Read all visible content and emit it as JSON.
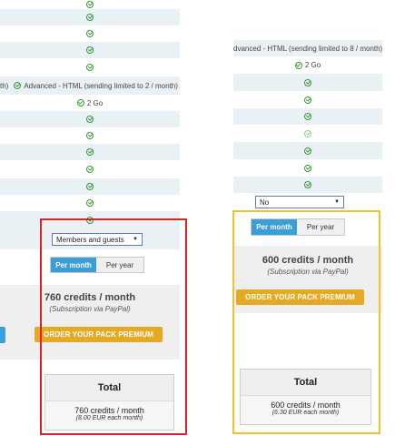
{
  "left_table": {
    "advanced_text": "Advanced - HTML (sending limited to 2 / month)",
    "advanced_prefix": "th)",
    "storage_text": "2 Go"
  },
  "right_table": {
    "advanced_text": "dvanced - HTML (sending limited to 8 / month)",
    "storage_text": "2 Go",
    "select_value": "No"
  },
  "left_panel": {
    "audience_select": "Members and guests",
    "toggle_on": "Per month",
    "toggle_off": "Per year",
    "price": "760 credits / month",
    "price_note": "(Subscription via PayPal)",
    "order_button": "ORDER YOUR PACK PREMIUM",
    "total_label": "Total",
    "total_value": "760 credits / month",
    "total_note": "(8.00 EUR each month)"
  },
  "right_panel": {
    "toggle_on": "Per month",
    "toggle_off": "Per year",
    "price": "600 credits / month",
    "price_note": "(Subscription via PayPal)",
    "order_button": "ORDER YOUR PACK PREMIUM",
    "total_label": "Total",
    "total_value": "600 credits / month",
    "total_note": "(6.30 EUR each month)"
  },
  "colors": {
    "highlight_red": "#dd2222",
    "highlight_yellow": "#f5c12a",
    "accent_blue": "#3a9fd9",
    "order_orange": "#e6a924"
  }
}
